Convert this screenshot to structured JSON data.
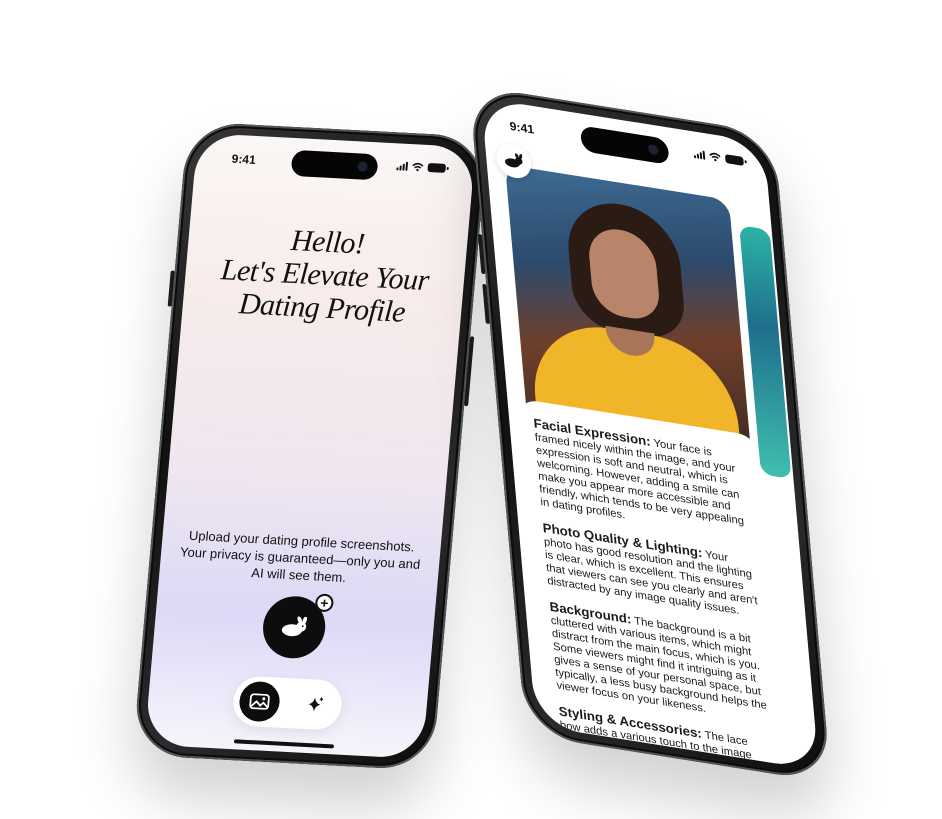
{
  "left_phone": {
    "status_time": "9:41",
    "title_lines": [
      "Hello!",
      "Let's Elevate Your",
      "Dating Profile"
    ],
    "upload_text": "Upload your dating profile screenshots. Your privacy is guaranteed—only you and AI will see them.",
    "upload_icon": "rabbit-icon",
    "upload_badge": "+",
    "tabs": [
      {
        "name": "gallery",
        "icon": "image-icon",
        "active": true
      },
      {
        "name": "enhance",
        "icon": "sparkle-icon",
        "active": false
      }
    ]
  },
  "right_phone": {
    "status_time": "9:41",
    "logo_icon": "rabbit-icon",
    "feedback": [
      {
        "heading": "Facial Expression:",
        "body": "Your face is framed nicely within the image, and your expression is soft and neutral, which is welcoming. However, adding a smile can make you appear more accessible and friendly, which tends to be very appealing in dating profiles."
      },
      {
        "heading": "Photo Quality & Lighting:",
        "body": "Your photo has good resolution and the lighting is clear, which is excellent. This ensures that viewers can see you clearly and aren't distracted by any image quality issues."
      },
      {
        "heading": "Background:",
        "body": "The background is a bit cluttered with various items, which might distract from the main focus, which is you. Some viewers might find it intriguing as it gives a sense of your personal space, but typically, a less busy background helps the viewer focus on your likeness."
      },
      {
        "heading": "Styling & Accessories:",
        "body": "The lace bow adds a various touch to the image and it speaks to your"
      }
    ]
  }
}
